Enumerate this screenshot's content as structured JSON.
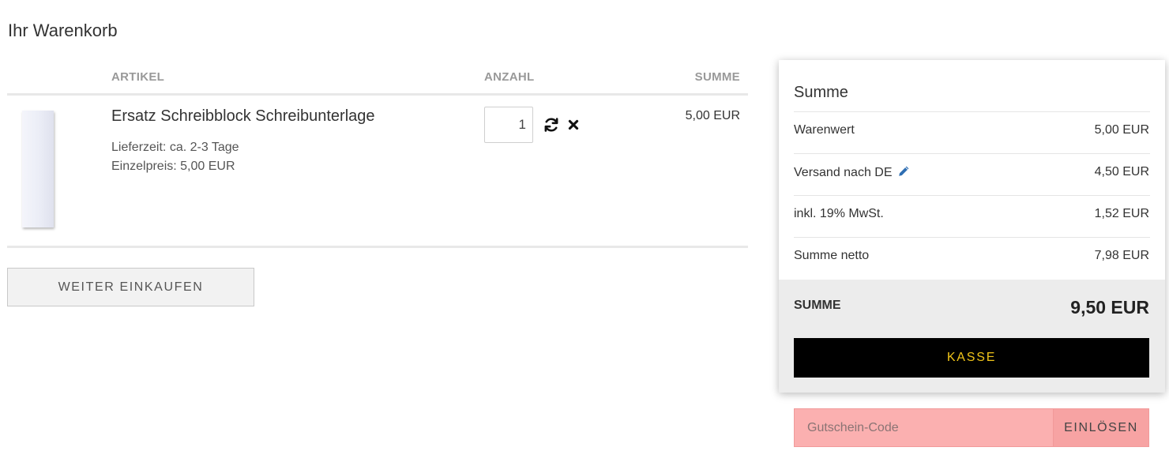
{
  "page": {
    "title": "Ihr Warenkorb"
  },
  "cart": {
    "columns": {
      "artikel": "ARTIKEL",
      "anzahl": "ANZAHL",
      "summe": "SUMME"
    },
    "items": [
      {
        "name": "Ersatz Schreibblock Schreibunterlage",
        "lieferzeit": "Lieferzeit: ca. 2-3 Tage",
        "einzelpreis": "Einzelpreis: 5,00 EUR",
        "quantity": "1",
        "sum": "5,00 EUR",
        "icons": {
          "refresh": "refresh-icon",
          "remove": "close-icon"
        }
      }
    ],
    "continue_label": "WEITER EINKAUFEN"
  },
  "summary": {
    "title": "Summe",
    "rows": [
      {
        "label": "Warenwert",
        "value": "5,00 EUR"
      },
      {
        "label": "Versand nach DE",
        "value": "4,50 EUR",
        "icon": "pencil-icon"
      },
      {
        "label": "inkl. 19% MwSt.",
        "value": "1,52 EUR"
      },
      {
        "label": "Summe netto",
        "value": "7,98 EUR"
      }
    ],
    "total_label": "SUMME",
    "total_value": "9,50 EUR",
    "checkout_label": "KASSE"
  },
  "coupon": {
    "placeholder": "Gutschein-Code",
    "value": "",
    "button_label": "EINLÖSEN"
  },
  "colors": {
    "checkout_bg": "#000000",
    "checkout_text": "#f0c419",
    "coupon_bg": "#fbb0b0",
    "pencil": "#2f6fb3",
    "total_band": "#ececec"
  }
}
